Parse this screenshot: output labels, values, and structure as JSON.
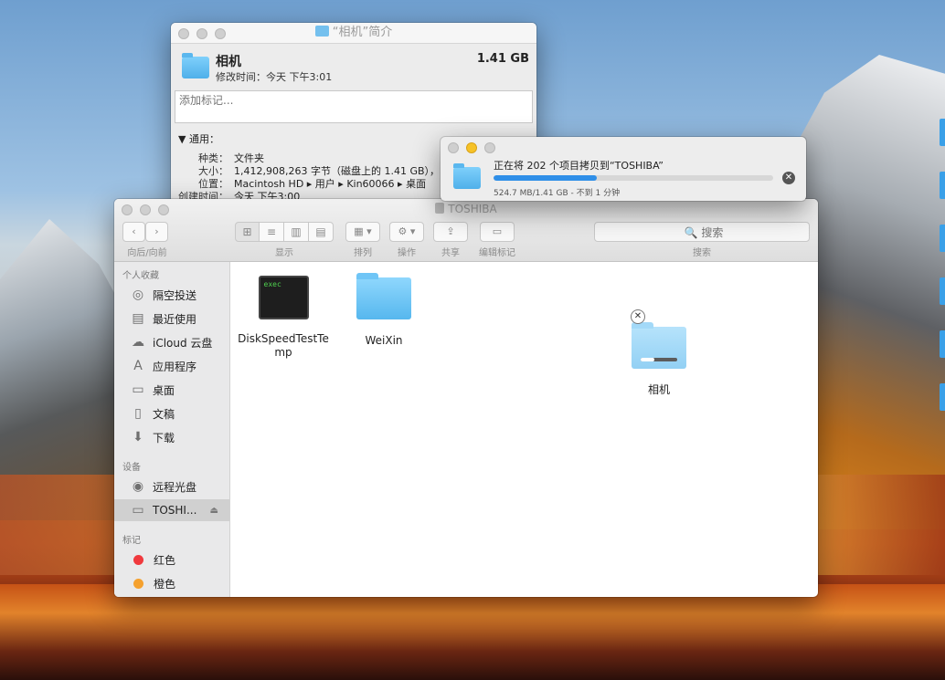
{
  "info_window": {
    "title": "“相机”简介",
    "name": "相机",
    "modified": "修改时间：今天 下午3:01",
    "size": "1.41 GB",
    "tags_placeholder": "添加标记...",
    "section": "通用：",
    "rows": [
      {
        "k": "种类：",
        "v": "文件夹"
      },
      {
        "k": "大小：",
        "v": "1,412,908,263 字节（磁盘上的 1.41 GB），"
      },
      {
        "k": "位置：",
        "v": "Macintosh HD ▸ 用户 ▸ Kin60066 ▸ 桌面"
      },
      {
        "k": "创建时间：",
        "v": "今天 下午3:00"
      }
    ]
  },
  "copy_window": {
    "message": "正在将 202 个项目拷贝到“TOSHIBA”",
    "progress": 0.37,
    "status": "524.7 MB/1.41 GB - 不到 1 分钟"
  },
  "finder": {
    "title": "TOSHIBA",
    "toolbar": {
      "nav_label": "向后/向前",
      "view_label": "显示",
      "arrange_label": "排列",
      "action_label": "操作",
      "share_label": "共享",
      "edit_tags_label": "编辑标记",
      "search_label": "搜索",
      "search_placeholder": "🔍 搜索"
    },
    "sidebar": {
      "favorites_header": "个人收藏",
      "favorites": [
        "隔空投送",
        "最近使用",
        "iCloud 云盘",
        "应用程序",
        "桌面",
        "文稿",
        "下载"
      ],
      "devices_header": "设备",
      "devices": [
        "远程光盘",
        "TOSHI..."
      ],
      "tags_header": "标记",
      "tags": [
        {
          "label": "红色",
          "color": "#f0393d"
        },
        {
          "label": "橙色",
          "color": "#f5a12e"
        }
      ]
    },
    "files": [
      {
        "name": "DiskSpeedTestTemp",
        "icon": "exec",
        "icon_text": "exec"
      },
      {
        "name": "WeiXin",
        "icon": "folder"
      },
      {
        "name": "相机",
        "icon": "folder-copying",
        "progress": 0.37
      }
    ]
  }
}
